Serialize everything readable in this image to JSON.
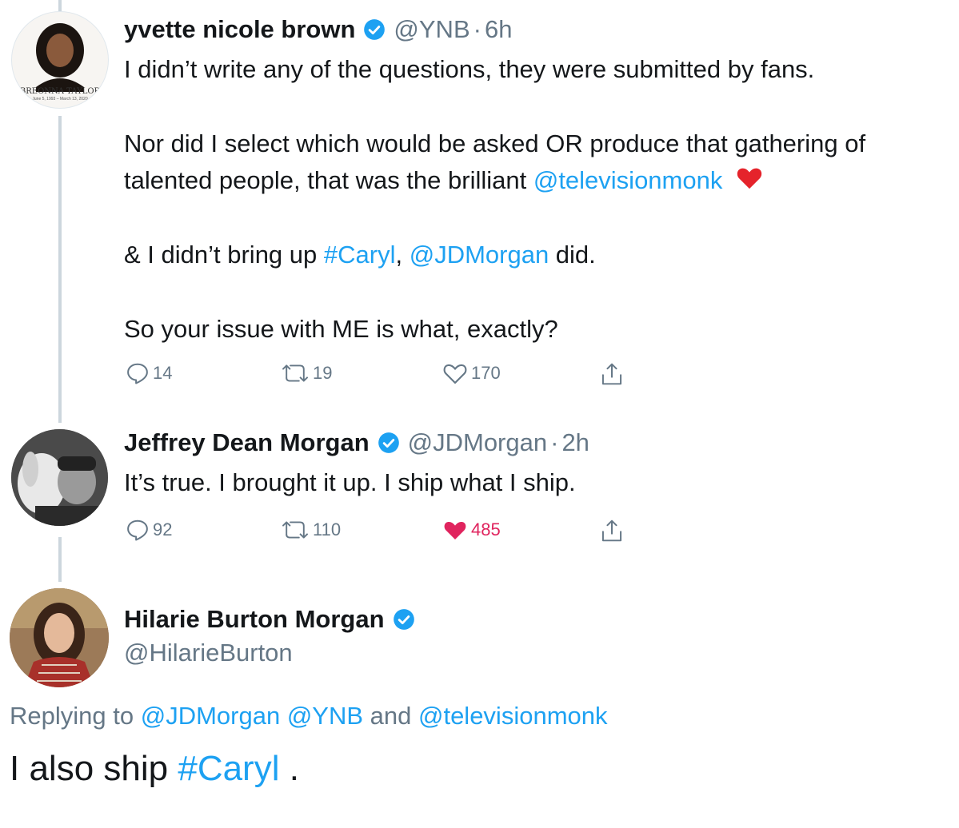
{
  "tweets": [
    {
      "name": "yvette nicole brown",
      "handle": "@YNB",
      "sep": "·",
      "time": "6h",
      "avatar_caption": "BREONNA TAYLOR",
      "avatar_subcaption": "June 5, 1993 – March 13, 2020",
      "lines": [
        "I didn’t write any of the questions, they were submitted by fans.",
        "Nor did I select which would be asked OR produce that gathering of",
        "talented people, that was the brilliant ",
        "@televisionmonk",
        "& I didn’t bring up ",
        "#Caryl",
        ", ",
        "@JDMorgan",
        " did.",
        "So your issue with ME is what, exactly?"
      ],
      "replies": "14",
      "retweets": "19",
      "likes": "170"
    },
    {
      "name": "Jeffrey Dean Morgan",
      "handle": "@JDMorgan",
      "sep": "·",
      "time": "2h",
      "text": "It’s true. I brought it up. I ship what I ship.",
      "replies": "92",
      "retweets": "110",
      "likes": "485"
    },
    {
      "name": "Hilarie Burton Morgan",
      "handle": "@HilarieBurton",
      "replying_prefix": "Replying to ",
      "replying_a": "@JDMorgan",
      "replying_b": "@YNB",
      "replying_and": " and ",
      "replying_c": "@televisionmonk",
      "text_a": "I also ship ",
      "text_tag": "#Caryl",
      "text_b": " ."
    }
  ],
  "colors": {
    "link": "#1da1f2",
    "secondary": "#657786",
    "like_active": "#e0245e",
    "thread_line": "#ccd6dd"
  }
}
